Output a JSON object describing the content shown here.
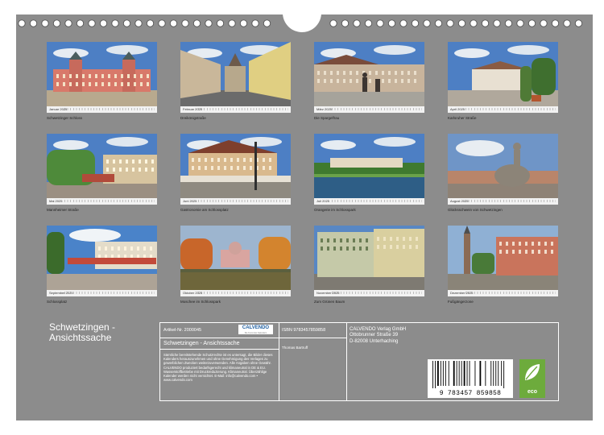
{
  "photos": [
    {
      "month": "Januar 2025",
      "caption": "Schwetzinger Schloss",
      "scene": "palace"
    },
    {
      "month": "Februar 2025",
      "caption": "Dreikönigstraße",
      "scene": "street"
    },
    {
      "month": "März 2025",
      "caption": "Die Spargelfrau",
      "scene": "statue-square"
    },
    {
      "month": "April 2025",
      "caption": "Karlsruher Straße",
      "scene": "plaza"
    },
    {
      "month": "Mai 2025",
      "caption": "Mannheimer Straße",
      "scene": "green-street"
    },
    {
      "month": "Juni 2025",
      "caption": "Gastronomie am Schlossplatz",
      "scene": "cafe"
    },
    {
      "month": "Juli 2025",
      "caption": "Orangerie im Schlosspark",
      "scene": "park-pond"
    },
    {
      "month": "August 2025",
      "caption": "Glücksschwein von Schwetzingen",
      "scene": "pig-statue"
    },
    {
      "month": "September 2025",
      "caption": "Schlossplatz",
      "scene": "square"
    },
    {
      "month": "Oktober 2025",
      "caption": "Moschee im Schlosspark",
      "scene": "mosque"
    },
    {
      "month": "November 2025",
      "caption": "Zum Grünen Baum",
      "scene": "inn"
    },
    {
      "month": "Dezember 2025",
      "caption": "Fußgängerzone",
      "scene": "pedestrian"
    }
  ],
  "cover": {
    "title_line1": "Schwetzingen -",
    "title_line2": "Ansichtssache"
  },
  "info": {
    "article_no": "Artikel-Nr. 2000045",
    "title": "Schwetzingen - Ansichtssache",
    "body_text": "Sämtliche bereitstehende Schutzrechte ist es untersagt, die Bilder dieses Kalenders herauszunehmen und ohne Genehmigung des Verlages zu gewerblichen Zwecken weiterzuverwenden. Alle Angaben ohne Gewähr. CALVENDO produziert bedarfsgerecht und klimaneutral in DE & EU. Wasserstoffbetriebe mit Druckreduzierung. Klimaneutral. Überzählige Kalender werden nicht vernichtet. E-Mail: info@calvendo.com • www.calvendo.com",
    "isbn": "ISBN 9783457859858",
    "author": "Thomas Bartruff",
    "publisher_line1": "CALVENDO Verlag GmbH",
    "publisher_line2": "Ottobrunner Straße 39",
    "publisher_line3": "D-82008 Unterhaching",
    "logo_text": "CALVENDO",
    "logo_sub": "Die Kunst des Kalenders"
  },
  "barcode": {
    "digits": "9 783457 859858"
  },
  "eco_badge": {
    "label": "eco"
  },
  "colors": {
    "cover_gray": "#8c8c8c",
    "eco_green": "#6dab3c",
    "logo_blue": "#1f5fa0"
  }
}
